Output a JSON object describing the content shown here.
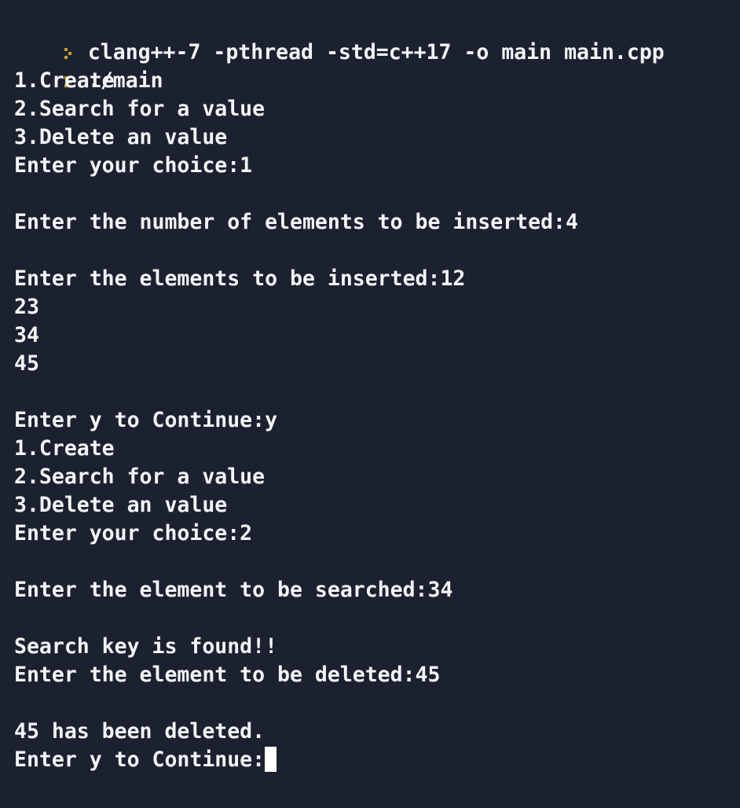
{
  "terminal": {
    "prompt_color": "#c9a227",
    "background": "#1c2130",
    "foreground": "#f2f4f8",
    "command_line_1": "clang++-7 -pthread -std=c++17 -o main main.cpp",
    "command_line_2": "./main",
    "output": [
      "1.Create",
      "2.Search for a value",
      "3.Delete an value",
      "Enter your choice:1",
      "",
      "Enter the number of elements to be inserted:4",
      "",
      "Enter the elements to be inserted:12",
      "23",
      "34",
      "45",
      "",
      "Enter y to Continue:y",
      "1.Create",
      "2.Search for a value",
      "3.Delete an value",
      "Enter your choice:2",
      "",
      "Enter the element to be searched:34",
      "",
      "Search key is found!!",
      "Enter the element to be deleted:45",
      "",
      "45 has been deleted."
    ],
    "last_line": "Enter y to Continue:"
  }
}
